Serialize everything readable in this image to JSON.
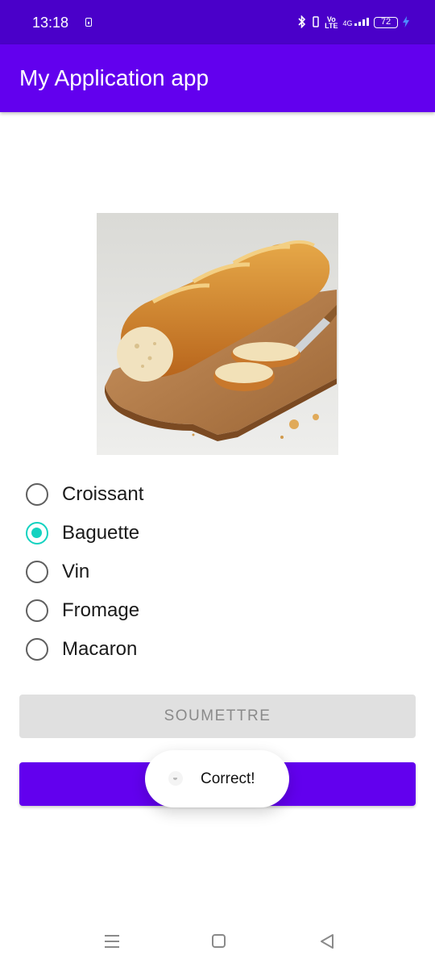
{
  "status_bar": {
    "time": "13:18",
    "battery_level": "72",
    "network": "4G",
    "volte_line1": "Vo",
    "volte_line2": "LTE",
    "icons": [
      "battery-saver-icon",
      "bluetooth-icon",
      "vibrate-icon",
      "volte-icon",
      "signal-4g-icon",
      "battery-icon",
      "charging-icon"
    ]
  },
  "app_bar": {
    "title": "My Application app"
  },
  "quiz": {
    "image": "baguette-bread-image",
    "options": [
      {
        "label": "Croissant",
        "checked": false
      },
      {
        "label": "Baguette",
        "checked": true
      },
      {
        "label": "Vin",
        "checked": false
      },
      {
        "label": "Fromage",
        "checked": false
      },
      {
        "label": "Macaron",
        "checked": false
      }
    ],
    "submit_label": "SOUMETTRE",
    "next_label": ""
  },
  "toast": {
    "message": "Correct!"
  },
  "nav_bar": {
    "icons": [
      "recents-menu-icon",
      "home-icon",
      "back-icon"
    ]
  },
  "colors": {
    "status_bar": "#4a00c9",
    "primary": "#6200ee",
    "radio_checked": "#14d2c0",
    "button_disabled": "#e0e0e0"
  }
}
